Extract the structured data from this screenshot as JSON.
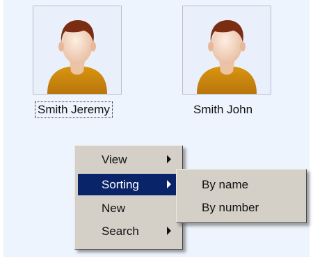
{
  "contacts": [
    {
      "name": "Smith Jeremy",
      "icon": "user-avatar-icon",
      "focused": true
    },
    {
      "name": "Smith John",
      "icon": "user-avatar-icon",
      "focused": false
    }
  ],
  "context_menu": {
    "items": [
      {
        "label": "View",
        "has_submenu": true,
        "selected": false
      },
      {
        "label": "Sorting",
        "has_submenu": true,
        "selected": true
      },
      {
        "label": "New",
        "has_submenu": false,
        "selected": false
      },
      {
        "label": "Search",
        "has_submenu": true,
        "selected": false
      }
    ]
  },
  "sorting_submenu": {
    "items": [
      {
        "label": "By name"
      },
      {
        "label": "By number"
      }
    ]
  },
  "colors": {
    "pane_background": "#edf4fd",
    "menu_background": "#d4d0c8",
    "menu_selection": "#0a246a",
    "avatar_shirt": "#c8860f",
    "avatar_hair": "#7a2d12"
  }
}
